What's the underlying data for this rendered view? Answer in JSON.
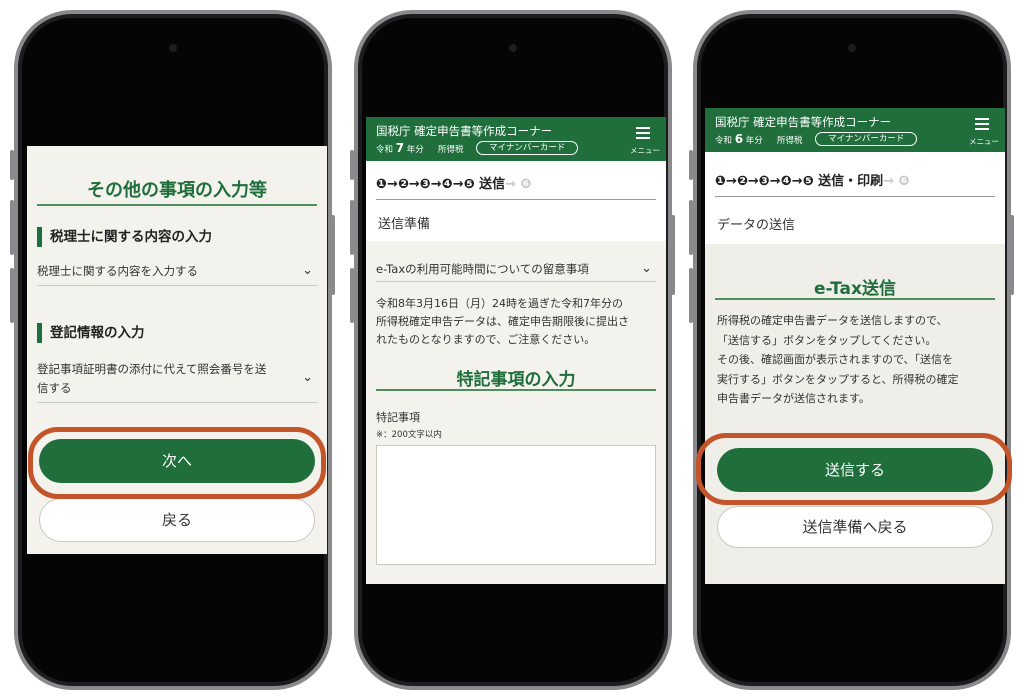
{
  "screen1": {
    "title": "その他の事項の入力等",
    "section1_heading": "税理士に関する内容の入力",
    "section1_item": "税理士に関する内容を入力する",
    "section2_heading": "登記情報の入力",
    "section2_item_line1": "登記事項証明書の添付に代えて照会番号を送",
    "section2_item_line2": "信する",
    "next_button": "次へ",
    "back_button": "戻る"
  },
  "header2": {
    "agency": "国税庁 確定申告書等作成コーナー",
    "era": "令和",
    "year": "7",
    "year_suffix": "年分",
    "tax": "所得税",
    "card": "マイナンバーカード",
    "menu": "メニュー"
  },
  "header3": {
    "agency": "国税庁 確定申告書等作成コーナー",
    "era": "令和",
    "year": "6",
    "year_suffix": "年分",
    "tax": "所得税",
    "card": "マイナンバーカード",
    "menu": "メニュー"
  },
  "screen2": {
    "stepper_done": "❶→❷→❸→❹→❺ 送信",
    "stepper_rest": "→ ❻",
    "page_title": "送信準備",
    "accordion": "e-Taxの利用可能時間についての留意事項",
    "notice_line1": "令和8年3月16日（月）24時を過ぎた令和7年分の",
    "notice_line2": "所得税確定申告データは、確定申告期限後に提出さ",
    "notice_line3": "れたものとなりますので、ご注意ください。",
    "special_heading": "特記事項の入力",
    "field_label": "特記事項",
    "field_hint": "※：200文字以内"
  },
  "screen3": {
    "stepper_done": "❶→❷→❸→❹→❺ 送信・印刷",
    "stepper_rest": "→ ❻",
    "page_title": "データの送信",
    "etax_heading": "e-Tax送信",
    "desc_line1": "所得税の確定申告書データを送信しますので、",
    "desc_line2": "「送信する」ボタンをタップしてください。",
    "desc_line3": "その後、確認画面が表示されますので、「送信を",
    "desc_line4": "実行する」ボタンをタップすると、所得税の確定",
    "desc_line5": "申告書データが送信されます。",
    "send_button": "送信する",
    "back_button": "送信準備へ戻る"
  },
  "colors": {
    "brand_green": "#1f6e3c",
    "highlight": "#c4542a",
    "screen_bg": "#f3f2ec"
  }
}
